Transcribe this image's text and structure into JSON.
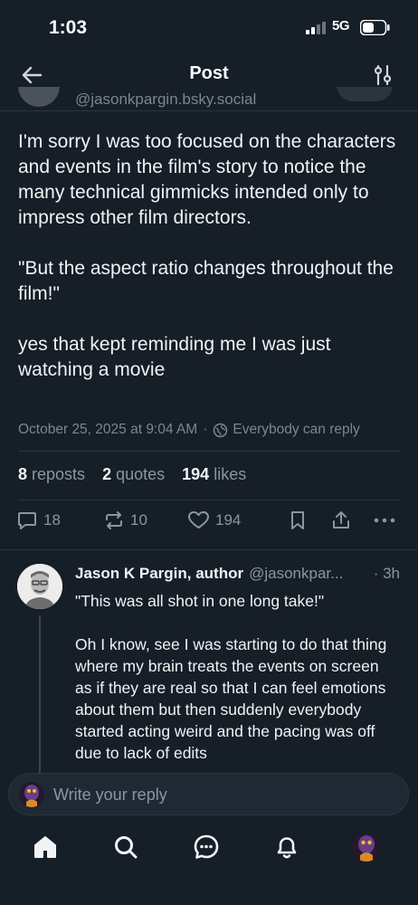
{
  "status_bar": {
    "time": "1:03",
    "network": "5G"
  },
  "header": {
    "title": "Post"
  },
  "author": {
    "handle": "@jasonkpargin.bsky.social"
  },
  "post": {
    "paragraphs": [
      "I'm sorry I was too focused on the characters and events in the film's story to notice the many technical gimmicks intended only to impress other film directors.",
      "\"But the aspect ratio changes throughout the film!\"",
      "yes that kept reminding me I was just watching a movie"
    ],
    "timestamp": "October 25, 2025 at 9:04 AM",
    "separator": "·",
    "reply_setting": "Everybody can reply"
  },
  "stats": {
    "reposts_count": "8",
    "reposts_label": "reposts",
    "quotes_count": "2",
    "quotes_label": "quotes",
    "likes_count": "194",
    "likes_label": "likes"
  },
  "actions": {
    "replies": "18",
    "reposts": "10",
    "likes": "194"
  },
  "reply": {
    "name": "Jason K Pargin, author",
    "handle": "@jasonkpar...",
    "time": "· 3h",
    "paragraphs": [
      "\"This was all shot in one long take!\"",
      "Oh I know, see I was starting to do that thing where my brain treats the events on screen as if they are real so that I can feel emotions about them but then suddenly everybody started acting weird and the pacing was off due to lack of edits"
    ]
  },
  "compose": {
    "placeholder": "Write your reply"
  },
  "colors": {
    "background": "#161e27",
    "text": "#f1f3f5",
    "muted": "#8a96a3",
    "divider": "#2b3540"
  },
  "bottom_nav": [
    "home-icon",
    "search-icon",
    "chat-icon",
    "bell-icon",
    "profile-avatar"
  ]
}
